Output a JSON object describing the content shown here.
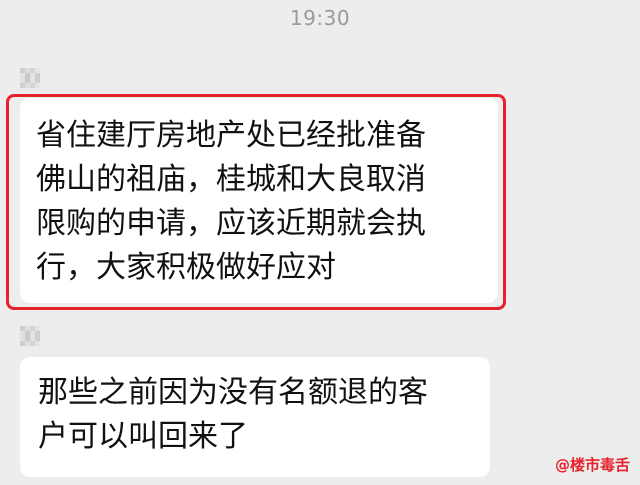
{
  "chat": {
    "timestamp": "19:30",
    "messages": [
      {
        "lines": [
          "省住建厅房地产处已经批准备",
          "佛山的祖庙，桂城和大良取消",
          "限购的申请，应该近期就会执",
          "行，大家积极做好应对"
        ],
        "highlighted": true
      },
      {
        "lines": [
          "那些之前因为没有名额退的客",
          "户可以叫回来了"
        ],
        "highlighted": false
      }
    ]
  },
  "watermark": {
    "text": "@楼市毒舌"
  },
  "colors": {
    "background": "#ededed",
    "bubble": "#ffffff",
    "highlight_border": "#e8222b",
    "timestamp": "#9a9a9a"
  }
}
